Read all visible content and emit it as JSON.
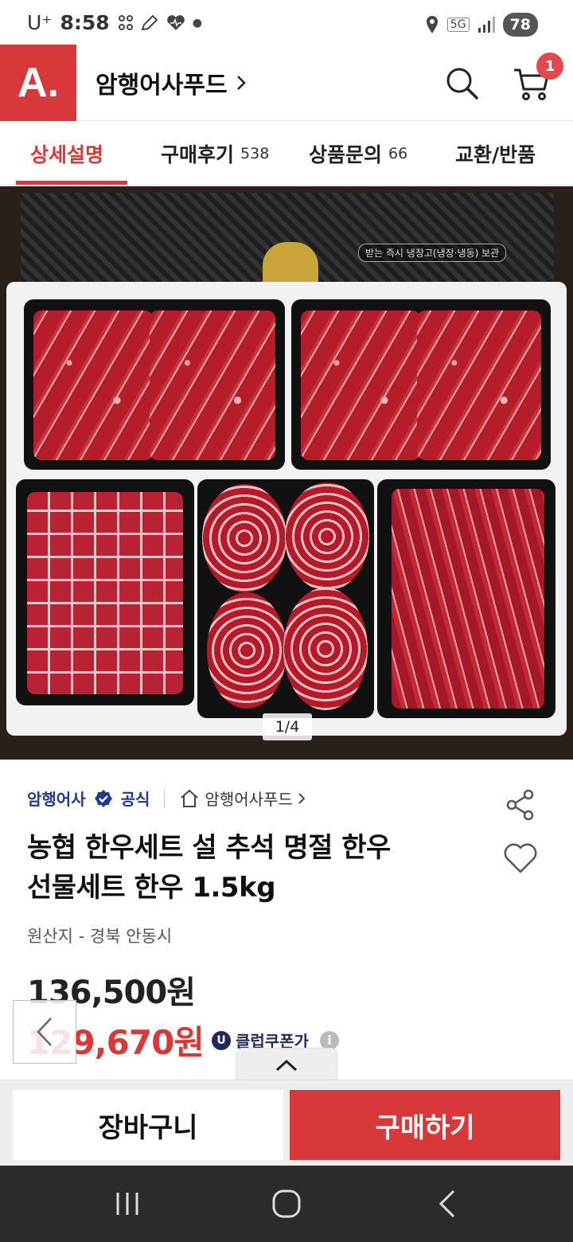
{
  "status_bar": {
    "carrier": "U⁺",
    "time": "8:58",
    "network": "5G",
    "battery": "78"
  },
  "header": {
    "logo_text": "A.",
    "brand_name": "암행어사푸드",
    "cart_count": "1"
  },
  "tabs": [
    {
      "label": "상세설명",
      "count": ""
    },
    {
      "label": "구매후기",
      "count": "538"
    },
    {
      "label": "상품문의",
      "count": "66"
    },
    {
      "label": "교환/반품",
      "count": ""
    }
  ],
  "gallery": {
    "counter": "1/4",
    "package_label": "받는 즉시 냉장고(냉장·냉동) 보관"
  },
  "seller": {
    "name": "암행어사",
    "official": "공식",
    "store_link": "암행어사푸드"
  },
  "product": {
    "title_line1": "농협 한우세트 설 추석 명절 한우",
    "title_line2": "선물세트 한우 1.5kg",
    "origin": "원산지 - 경북 안동시",
    "price_original": "136,500원",
    "price_sale": "129,670원",
    "coupon_label": "클럽쿠폰가",
    "coupon_badge": "U"
  },
  "actions": {
    "cart_button": "장바구니",
    "buy_button": "구매하기"
  },
  "colors": {
    "brand_red": "#d9383a",
    "seller_blue": "#1f3a8f",
    "nav_bar": "#2b2b2b"
  }
}
